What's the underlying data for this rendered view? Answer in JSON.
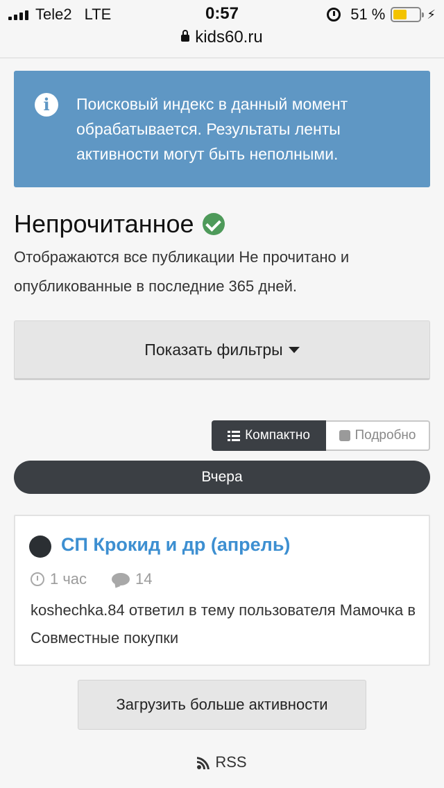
{
  "status_bar": {
    "carrier": "Tele2",
    "network": "LTE",
    "time": "0:57",
    "battery_percent": "51 %",
    "battery_level": 0.51,
    "url": "kids60.ru"
  },
  "alert": {
    "icon": "info-icon",
    "text": "Поисковый индекс в данный момент обрабатывается. Результаты ленты активности могут быть неполными."
  },
  "page": {
    "title": "Непрочитанное",
    "description": "Отображаются все публикации Не прочитано и опубликованные в последние 365 дней."
  },
  "filters": {
    "label": "Показать фильтры"
  },
  "view_toggle": {
    "compact_label": "Компактно",
    "detailed_label": "Подробно",
    "selected": "compact"
  },
  "date_group": {
    "label": "Вчера"
  },
  "activity": {
    "title": "СП Крокид и др (апрель)",
    "time_ago": "1 час",
    "comments": "14",
    "description": "koshechka.84 ответил в тему пользователя Мамочка в Совместные покупки"
  },
  "load_more": {
    "label": "Загрузить больше активности"
  },
  "rss": {
    "label": "RSS"
  },
  "colors": {
    "alert_bg": "#5f97c4",
    "dark": "#3b3f44",
    "link": "#3d8fd1",
    "success": "#4e9a5a",
    "battery": "#f3c300"
  }
}
